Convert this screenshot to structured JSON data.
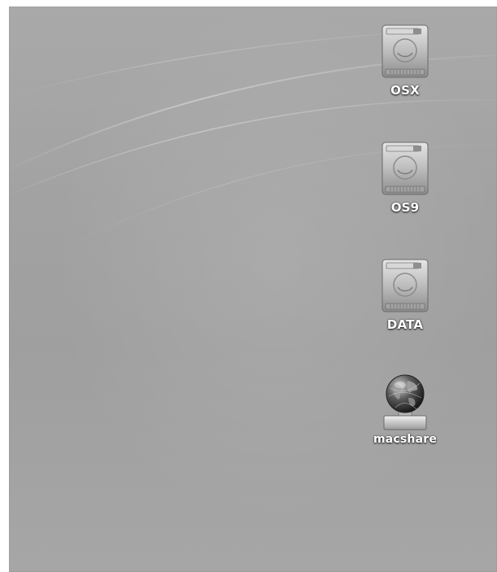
{
  "desktop": {
    "icons": [
      {
        "label": "OSX",
        "icon": "hard-drive-icon"
      },
      {
        "label": "OS9",
        "icon": "hard-drive-icon"
      },
      {
        "label": "DATA",
        "icon": "hard-drive-icon"
      },
      {
        "label": "macshare",
        "icon": "network-share-globe-icon"
      }
    ]
  }
}
